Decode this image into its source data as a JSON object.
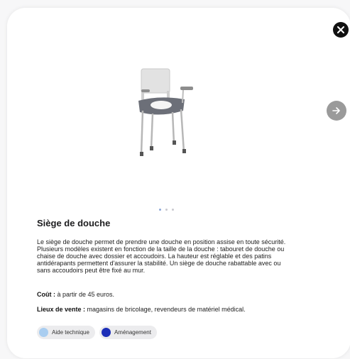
{
  "product": {
    "title": "Siège de douche",
    "description": "Le siège de douche permet de prendre une douche en position assise en toute sécurité. Plusieurs modèles existent en fonction de la taille de la douche : tabouret de douche ou chaise de douche avec dossier et accoudoirs. La hauteur est réglable et des patins antidérapants permettent d'assurer la stabilité. Un siège de douche rabattable avec ou sans accoudoirs peut être fixé au mur.",
    "cost_label": "Coût :",
    "cost_value": " à partir de 45 euros.",
    "places_label": "Lieux de vente :",
    "places_value": " magasins de bricolage, revendeurs de matériel médical."
  },
  "carousel": {
    "dot_count": 3,
    "active_index": 0
  },
  "tags": [
    {
      "label": "Aide technique",
      "color": "#a9cdf0"
    },
    {
      "label": "Aménagement",
      "color": "#1d2fb8"
    }
  ],
  "icons": {
    "close": "close-icon",
    "next": "arrow-right-icon",
    "image": "shower-chair-image"
  }
}
